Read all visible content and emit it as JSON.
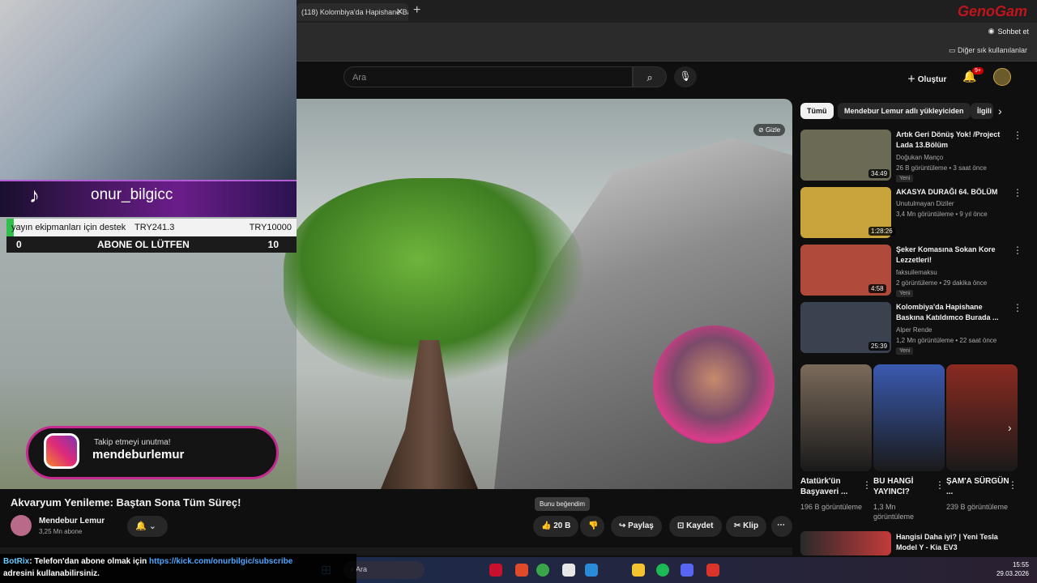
{
  "browser": {
    "tab_title": "(118) Kolombiya'da Hapishane Bas",
    "tab_close": "✕",
    "new_tab": "+",
    "copilot_label": "Sohbet et",
    "bookmarks_label": "Diğer sık kullanılanlar",
    "brand": "GenoGam"
  },
  "header": {
    "search_placeholder": "Ara",
    "create_label": "Oluştur",
    "notification_badge": "9+"
  },
  "stream": {
    "tiktok_user": "onur_bilgicc",
    "goal_text": "yayın ekipmanları için destek",
    "goal_current": "TRY241.3",
    "goal_target": "TRY10000",
    "goal_fraction": 0.024,
    "sub_min": "0",
    "sub_text": "ABONE OL LÜTFEN",
    "sub_max": "10",
    "insta_line1": "Takip etmeyi unutma!",
    "insta_line2": "mendeburlemur",
    "chat_user": "BotRix",
    "chat_text": ": Telefon'dan abone olmak için",
    "chat_link": "https://kick.com/onurbilgic/subscribe",
    "chat_text2": "adresini kullanabilirsiniz."
  },
  "video": {
    "hide_label": "Gizle",
    "title": "Akvaryum Yenileme: Baştan Sona Tüm Süreç!",
    "channel": "Mendebur Lemur",
    "subscribers": "3,25 Mn abone",
    "likes": "20 B",
    "like_tooltip": "Bunu beğendim",
    "share": "Paylaş",
    "save": "Kaydet",
    "clip": "Klip"
  },
  "sidebar": {
    "chips": [
      "Tümü",
      "Mendebur Lemur adlı yükleyiciden",
      "İlgili"
    ],
    "recommendations": [
      {
        "title": "Artık Geri Dönüş Yok! /Project Lada 13.Bölüm",
        "channel": "Doğukan Manço",
        "meta": "26 B görüntüleme • 3 saat önce",
        "badge": "Yeni",
        "duration": "34:49",
        "color": "#6a6a55"
      },
      {
        "title": "AKASYA DURAĞI 64. BÖLÜM",
        "channel": "Unutulmayan Diziler",
        "meta": "3,4 Mn görüntüleme • 9 yıl önce",
        "badge": "",
        "duration": "1:28:26",
        "color": "#c9a43a"
      },
      {
        "title": "Şeker Komasına Sokan Kore Lezzetleri!",
        "channel": "faksuilemaksu",
        "meta": "2 görüntüleme • 29 dakika önce",
        "badge": "Yeni",
        "duration": "4:58",
        "color": "#b04a3a"
      },
      {
        "title": "Kolombiya'da Hapishane Baskına Katıldımco Burada ...",
        "channel": "Alper Rende",
        "meta": "1,2 Mn görüntüleme • 22 saat önce",
        "badge": "Yeni",
        "duration": "25:39",
        "color": "#3a4250"
      }
    ],
    "shorts": [
      {
        "title": "Atatürk'ün Başyaveri ...",
        "views": "196 B görüntüleme",
        "color": "#7a6a5a"
      },
      {
        "title": "BU HANGİ YAYINCI?",
        "views": "1,3 Mn görüntüleme",
        "color": "#3a5ab0"
      },
      {
        "title": "ŞAM'A SÜRGÜN ...",
        "views": "239 B görüntüleme",
        "color": "#8a2a20"
      }
    ],
    "last_item_title": "Hangisi Daha iyi? | Yeni Tesla Model Y - Kia EV3"
  },
  "taskbar": {
    "search": "Ara",
    "time": "15:55",
    "date": "29.03.2026"
  }
}
